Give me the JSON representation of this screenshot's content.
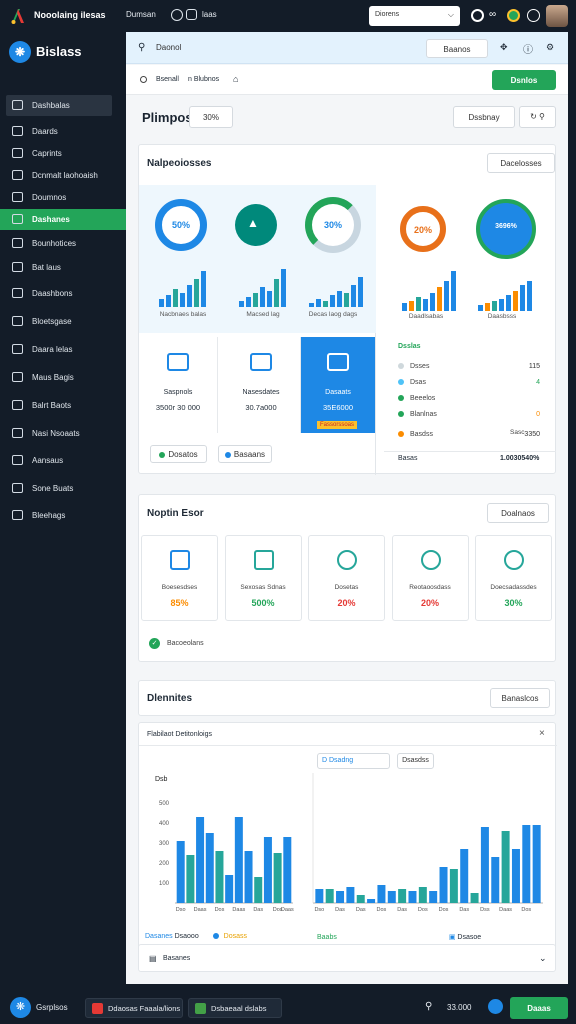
{
  "topbar": {
    "app_title": "Nooolaing ilesas",
    "mid_label": "Dumsan",
    "mid_label2": "laas",
    "select_value": "Diorens",
    "colors": {
      "logo_green": "#23a559",
      "logo_red": "#e53935",
      "logo_yellow": "#fbc02d"
    }
  },
  "sidebar": {
    "brand": "Bislass",
    "items": [
      {
        "label": "Dashbalas",
        "icon": "monitor-icon"
      },
      {
        "label": "Daards",
        "icon": "grid-icon"
      },
      {
        "label": "Caprints",
        "icon": "chart-icon"
      },
      {
        "label": "Dcnmalt laohoaish",
        "icon": "close-box-icon"
      },
      {
        "label": "Doumnos",
        "icon": "briefcase-icon"
      },
      {
        "label": "Dashanes",
        "icon": "dashboard-icon"
      },
      {
        "label": "Bounhotices",
        "icon": "window-icon"
      },
      {
        "label": "Bat laus",
        "icon": "bag-icon"
      },
      {
        "label": "Daashbons",
        "icon": "file-icon"
      },
      {
        "label": "Bloetsgase",
        "icon": "folder-icon"
      },
      {
        "label": "Daara lelas",
        "icon": "inbox-icon"
      },
      {
        "label": "Maus Bagis",
        "icon": "bird-icon"
      },
      {
        "label": "Balrt Baots",
        "icon": "trend-icon"
      },
      {
        "label": "Nasi Nsoaats",
        "icon": "x-box-icon"
      },
      {
        "label": "Aansaus",
        "icon": "clock-icon"
      },
      {
        "label": "Sone Buats",
        "icon": "pencil-icon"
      },
      {
        "label": "Bleehags",
        "icon": "folder-icon"
      }
    ]
  },
  "main": {
    "search_placeholder": "Daonol",
    "search_button": "Baanos",
    "breadcrumb": [
      "Bsenall",
      "n Blubnos"
    ],
    "header_action": "Dsnlos",
    "page_title": "Plimpos:",
    "title_badge": "30%",
    "toolbar_btn": "Dssbnay",
    "section1": {
      "title": "Nalpeoiosses",
      "action": "Dacelosses",
      "rings": [
        {
          "value": "50%",
          "caption": "Nacbnaes balas",
          "color": "#1e88e5"
        },
        {
          "value": "",
          "caption": "Macsed lag",
          "color": "#00897b"
        },
        {
          "value": "30%",
          "caption": "Decas laog dags",
          "color": "#26a69a"
        }
      ],
      "tiles": [
        {
          "title": "Saspnols",
          "value": "3500r 30 000"
        },
        {
          "title": "Nasesdates",
          "value": "30.7a000"
        },
        {
          "title": "Dasaats",
          "value": "35E6000",
          "badge": "Fassorssoas"
        }
      ],
      "btn_left": "Dosatos",
      "btn_right": "Basaans",
      "right_rings": [
        {
          "value": "20%",
          "caption": "Daadlsabas",
          "color": "#e8701a"
        },
        {
          "value": "3696%",
          "caption": "Daasbsss",
          "color": "#1e88e5"
        }
      ],
      "panel_title": "Dsslas",
      "legend": [
        {
          "label": "Dsses",
          "value": "115",
          "color": "#cfd8dc"
        },
        {
          "label": "Dsas",
          "value": "4",
          "color": "#4fc3f7"
        },
        {
          "label": "Beeelos",
          "value": "",
          "color": "#23a559"
        },
        {
          "label": "Blanlnas",
          "value": "0",
          "color": "#23a559"
        },
        {
          "label": "Basdss",
          "value": "3350",
          "color": "#fb8c00"
        }
      ],
      "legend_extra": "Sasc",
      "footer_left": "Basas",
      "footer_right": "1.0030540%"
    },
    "section2": {
      "title": "Noptin Esor",
      "action": "Doalnaos",
      "tiles": [
        {
          "caption": "Boesesdses",
          "value": "85%",
          "color": "#fb8c00",
          "icon": "building-icon"
        },
        {
          "caption": "Sexosas Sdnas",
          "value": "500%",
          "color": "#23a559",
          "icon": "document-icon"
        },
        {
          "caption": "Dosetas",
          "value": "20%",
          "color": "#e53935",
          "icon": "star-icon"
        },
        {
          "caption": "Reotaoosdass",
          "value": "20%",
          "color": "#e53935",
          "icon": "refresh-icon"
        },
        {
          "caption": "Doecsadassdes",
          "value": "30%",
          "color": "#23a559",
          "icon": "gear-icon"
        }
      ],
      "footer": "Bacoeolans"
    },
    "section3": {
      "title": "Dlennites",
      "action": "Banaslcos",
      "panel_title": "Flabilaot Detitonloigs",
      "filter1": "D Dsadng",
      "filter2": "Dsasdss",
      "footer_left_a": "Dasanes",
      "footer_left_b": "Dsaooo",
      "footer_left_c": "Dosass",
      "footer_right_a": "Baabs",
      "footer_right_b": "Dsasoe"
    },
    "collapsible": "Basanes"
  },
  "chart_data": [
    {
      "type": "bar",
      "title": "",
      "ylabel": "Dsb",
      "ylim": [
        0,
        500
      ],
      "y_ticks": [
        "100",
        "200",
        "300",
        "400",
        "500"
      ],
      "categories": [
        "Dso",
        "",
        "Daas",
        "",
        "Dos",
        "",
        "Daas",
        "",
        "Das",
        "",
        "Dos",
        "Daas"
      ],
      "values": [
        310,
        240,
        430,
        350,
        260,
        140,
        430,
        260,
        130,
        330,
        250,
        330
      ],
      "colors": [
        "#1e88e5",
        "#26a69a",
        "#1e88e5",
        "#1e88e5",
        "#26a69a",
        "#1e88e5",
        "#1e88e5",
        "#1e88e5",
        "#26a69a",
        "#1e88e5",
        "#26a69a",
        "#1e88e5"
      ]
    },
    {
      "type": "bar",
      "title": "",
      "ylim": [
        0,
        500
      ],
      "categories": [
        "Dso",
        "",
        "Das",
        "",
        "Das",
        "",
        "Dos",
        "",
        "Das",
        "",
        "Dos",
        "",
        "Dos",
        "",
        "Das",
        "",
        "Dss",
        "",
        "Daas",
        "",
        "Dos",
        ""
      ],
      "values": [
        70,
        70,
        60,
        80,
        40,
        20,
        90,
        60,
        70,
        60,
        80,
        60,
        180,
        170,
        270,
        50,
        380,
        230,
        360,
        270,
        390,
        390
      ],
      "colors": [
        "#1e88e5",
        "#26a69a",
        "#1e88e5",
        "#1e88e5",
        "#26a69a",
        "#1e88e5",
        "#1e88e5",
        "#1e88e5",
        "#26a69a",
        "#1e88e5",
        "#26a69a",
        "#1e88e5",
        "#1e88e5",
        "#26a69a",
        "#1e88e5",
        "#26a69a",
        "#1e88e5",
        "#1e88e5",
        "#26a69a",
        "#1e88e5",
        "#1e88e5",
        "#1e88e5"
      ]
    }
  ],
  "taskbar": {
    "start_label": "Gsrplsos",
    "tasks": [
      "Ddaosas Faaala/lions",
      "Dsbaeaal dslabs"
    ],
    "time": "33.000",
    "action": "Daaas"
  }
}
